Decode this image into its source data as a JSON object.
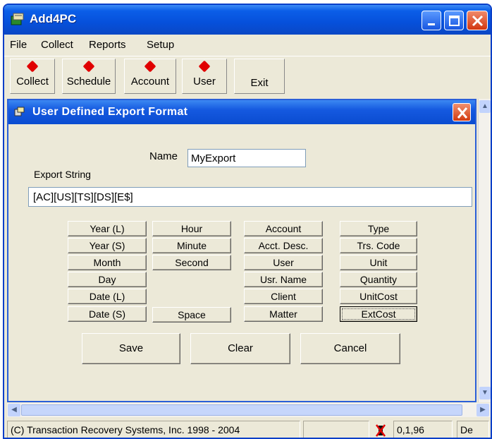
{
  "window": {
    "title": "Add4PC"
  },
  "menu": [
    "File",
    "Collect",
    "Reports",
    "Setup"
  ],
  "toolbar": [
    "Collect",
    "Schedule",
    "Account",
    "User",
    "Exit"
  ],
  "dialog": {
    "title": "User Defined Export Format",
    "name_label": "Name",
    "name_value": "MyExport",
    "export_label": "Export String",
    "export_value": "[AC][US][TS][DS][E$]"
  },
  "fields": {
    "col1": [
      "Year (L)",
      "Year (S)",
      "Month",
      "Day",
      "Date (L)",
      "Date (S)"
    ],
    "col2": [
      "Hour",
      "Minute",
      "Second"
    ],
    "space": "Space",
    "col3": [
      "Account",
      "Acct. Desc.",
      "User",
      "Usr. Name",
      "Client",
      "Matter"
    ],
    "col4": [
      "Type",
      "Trs. Code",
      "Unit",
      "Quantity",
      "UnitCost",
      "ExtCost"
    ]
  },
  "actions": {
    "save": "Save",
    "clear": "Clear",
    "cancel": "Cancel"
  },
  "status": {
    "copyright": "(C) Transaction Recovery Systems, Inc. 1998 - 2004",
    "coords": "0,1,96",
    "last": "De"
  },
  "colors": {
    "accent": "#0a4cd0",
    "close": "#d23a10",
    "marker": "#e00000"
  }
}
